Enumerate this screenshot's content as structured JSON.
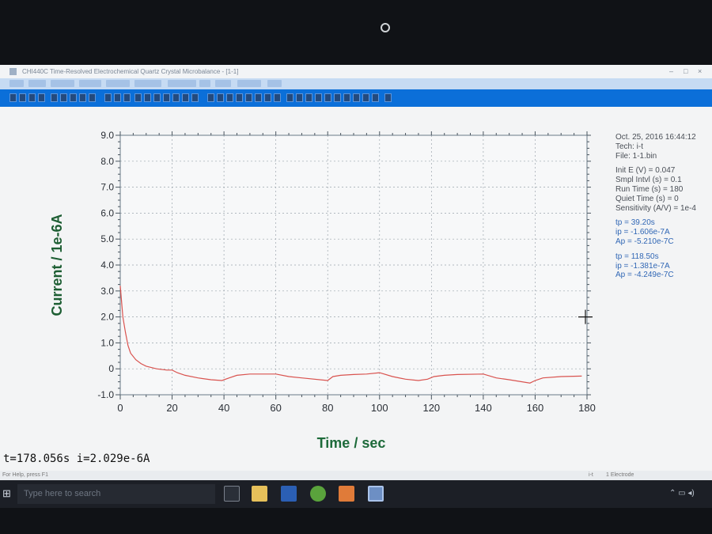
{
  "window": {
    "title": "CHI440C Time-Resolved Electrochemical Quartz Crystal Microbalance - [1-1]",
    "controls": [
      "–",
      "□",
      "×"
    ]
  },
  "chart_data": {
    "type": "line",
    "xlabel": "Time / sec",
    "ylabel": "Current / 1e-6A",
    "xlim": [
      0,
      180
    ],
    "ylim": [
      -1.0,
      9.0
    ],
    "x_ticks": [
      "0",
      "20",
      "40",
      "60",
      "80",
      "100",
      "120",
      "140",
      "160",
      "180"
    ],
    "y_ticks": [
      "9.0",
      "8.0",
      "7.0",
      "6.0",
      "5.0",
      "4.0",
      "3.0",
      "2.0",
      "1.0",
      "0",
      "-1.0"
    ],
    "grid": true,
    "series": [
      {
        "color": "#d9534f",
        "x": [
          0.0,
          1.0,
          2.0,
          3.0,
          4.0,
          6.0,
          8.0,
          10.0,
          14.0,
          18.0,
          20.0,
          22.0,
          25.0,
          30.0,
          35.0,
          39.2,
          42.0,
          45.0,
          50.0,
          60.0,
          65.0,
          70.0,
          80.0,
          82.0,
          85.0,
          90.0,
          95.0,
          100.0,
          105.0,
          110.0,
          115.0,
          118.5,
          121.0,
          125.0,
          130.0,
          140.0,
          145.0,
          150.0,
          158.0,
          160.0,
          163.0,
          170.0,
          178.0
        ],
        "y": [
          3.2,
          2.0,
          1.4,
          0.9,
          0.6,
          0.35,
          0.2,
          0.1,
          0.0,
          -0.05,
          -0.05,
          -0.15,
          -0.25,
          -0.35,
          -0.42,
          -0.45,
          -0.35,
          -0.25,
          -0.2,
          -0.2,
          -0.3,
          -0.35,
          -0.45,
          -0.3,
          -0.25,
          -0.22,
          -0.2,
          -0.15,
          -0.3,
          -0.4,
          -0.45,
          -0.4,
          -0.3,
          -0.25,
          -0.22,
          -0.2,
          -0.35,
          -0.42,
          -0.55,
          -0.45,
          -0.35,
          -0.3,
          -0.28
        ]
      }
    ]
  },
  "info_panel": {
    "date_time": "Oct. 25, 2016  16:44:12",
    "tech": "Tech: i-t",
    "file": "File: 1-1.bin",
    "params": [
      "Init E (V) = 0.047",
      "Smpl Intvl (s) = 0.1",
      "Run Time (s) = 180",
      "Quiet Time (s) = 0",
      "Sensitivity (A/V) = 1e-4"
    ],
    "peak1": [
      "tp = 39.20s",
      "ip = -1.606e-7A",
      "Ap = -5.210e-7C"
    ],
    "peak2": [
      "tp = 118.50s",
      "ip = -1.381e-7A",
      "Ap = -4.249e-7C"
    ]
  },
  "cursor_readout": "t=178.056s   i=2.029e-6A",
  "status_bar": {
    "help": "For Help, press F1",
    "mid": "i-t",
    "right": "1 Electrode"
  },
  "taskbar": {
    "search_placeholder": "Type here to search"
  }
}
